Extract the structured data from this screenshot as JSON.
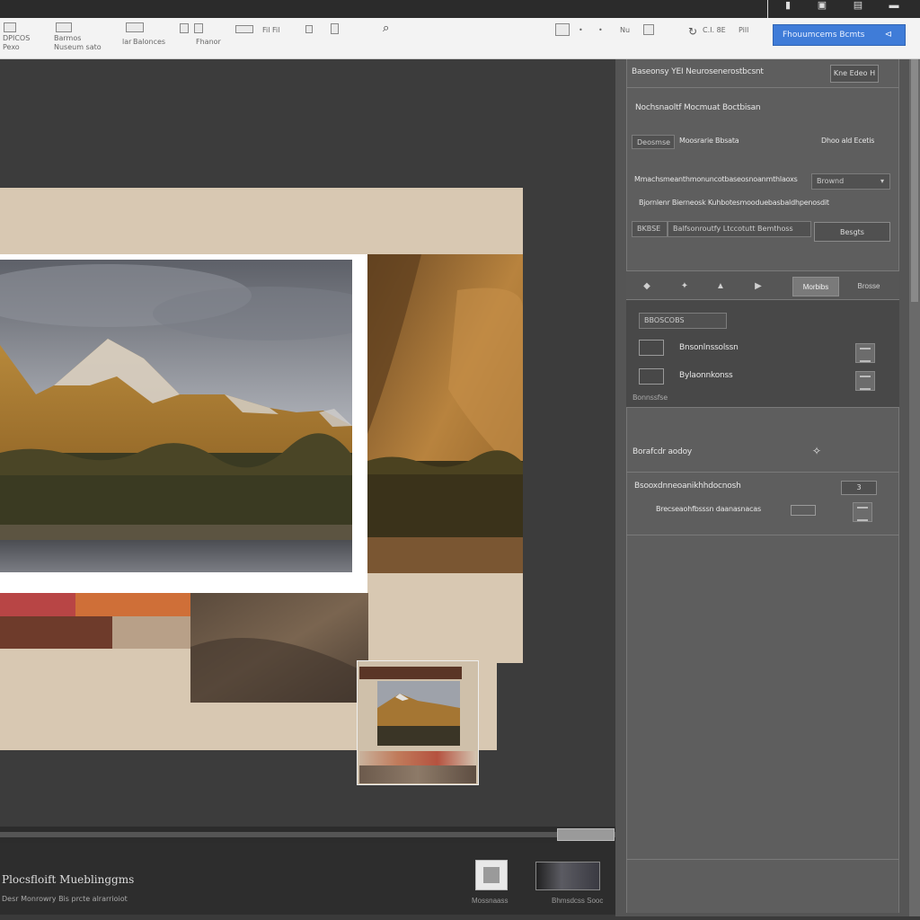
{
  "topbar": {
    "icons": [
      "▮",
      "▣",
      "▤",
      "▬"
    ]
  },
  "toolbar": {
    "group1_line1": "DPICOS",
    "group1_line2": "Pexo",
    "group2_line1": "Barmos",
    "group2_line2": "Nuseum sato",
    "group3_line1": "lar",
    "group3_line2": "Balonces",
    "group4": "Fhanor",
    "group5": "Fil Fil",
    "group6": "⌕",
    "right_label1": "C.I. 8E",
    "right_label2": "Pill",
    "right_label3": "Nu",
    "action_button": "Fhouumcems Bcmts",
    "action_button_icon": "⊲"
  },
  "panel": {
    "header": "Baseonsy YEI Neurosenerostbcsnt",
    "header_button": "Kne Edeo H",
    "section1_title": "Nochsnaoltf Mocmuat Boctbisan",
    "section1_field": "Deosmse",
    "section1_label": "Moosrarie Bbsata",
    "section1_value": "Dhoo ald Ecetis",
    "row1_label": "Mmachsmeanthmonuncotbaseosnoanmthlaoxs",
    "row1_select": "Brownd",
    "row1_select_icon": "▾",
    "row2_label": "Bjornlenr Bierneosk Kuhbotesmooduebasbaldhpenosdit",
    "row3_field1": "BKBSE",
    "row3_field2": "Balfsonroutfy Ltccotutt Bemthoss",
    "row3_button": "Besgts",
    "tabs": [
      "◆",
      "✦",
      "▲",
      "▶",
      "Morbibs",
      "Brosse"
    ],
    "layers_header": "BBOSCOBS",
    "layer1_label": "Bnsonlnssolssn",
    "layer2_label": "Bylaonnkonss",
    "layers_footer": "Bonnssfse",
    "section3_label": "Borafcdr aodoy",
    "section3_value": "✧",
    "section4_title": "Bsooxdnneoanikhhdocnosh",
    "section4_toggle": "3",
    "section4_sub": "Brecseaohfbsssn daanasnacas"
  },
  "status": {
    "title": "Plocsfloift Mueblinggms",
    "subtitle": "Desr Monrowry Bis prcte alrarrioiot",
    "btn1_label": "Mossnaass",
    "btn2_label": "Bhmsdcss Sooc"
  },
  "colors": {
    "accent": "#3f7cd8",
    "swatch_red": "#b84545",
    "swatch_orange": "#cf6f38",
    "swatch_brown": "#6e3b2b",
    "swatch_tan": "#b8a088",
    "sheet_beige": "#d8c8b2"
  }
}
